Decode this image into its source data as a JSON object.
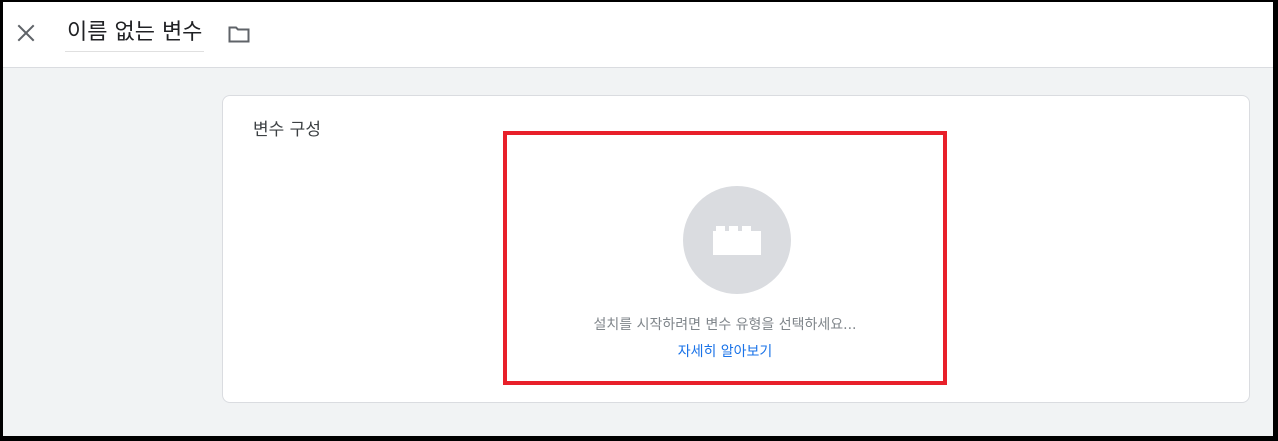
{
  "header": {
    "title": "이름 없는 변수",
    "close_icon": "close-icon",
    "folder_icon": "folder-icon"
  },
  "card": {
    "title": "변수 구성",
    "type_icon": "brick-icon",
    "prompt": "설치를 시작하려면 변수 유형을 선택하세요...",
    "learn_more": "자세히 알아보기"
  },
  "colors": {
    "background": "#f1f3f4",
    "highlight": "#e8202a",
    "link": "#1a73e8",
    "circle": "#dadce0"
  }
}
